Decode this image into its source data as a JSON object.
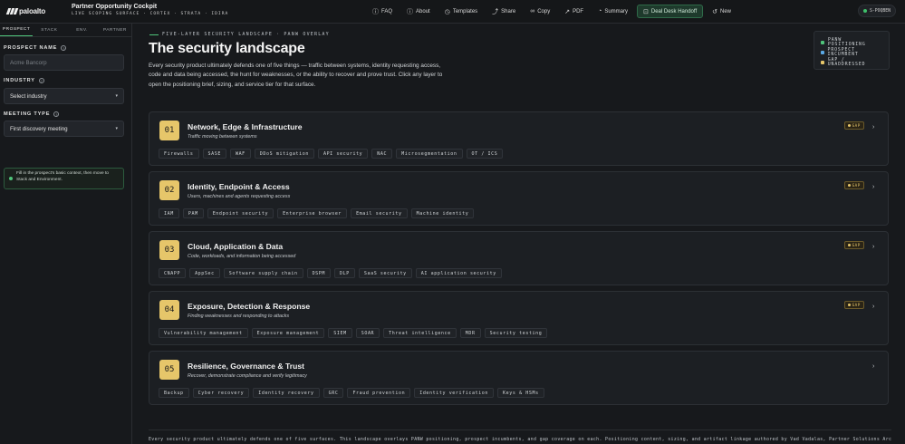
{
  "app": {
    "logo_text": "paloalto",
    "title": "Partner Opportunity Cockpit",
    "subtitle": "LIVE SCOPING SURFACE · CORTEX · STRATA · IDIRA"
  },
  "toolbar": {
    "faq": "FAQ",
    "about": "About",
    "templates": "Templates",
    "share": "Share",
    "copy": "Copy",
    "pdf": "PDF",
    "summary": "Summary",
    "handoff": "Deal Desk Handoff",
    "new": "New",
    "env_badge": "S-POQBEN"
  },
  "sidebar": {
    "tabs": [
      "PROSPECT",
      "STACK",
      "ENV.",
      "PARTNER"
    ],
    "prospect_label": "PROSPECT NAME",
    "prospect_placeholder": "Acme Bancorp",
    "industry_label": "INDUSTRY",
    "industry_value": "Select industry",
    "meeting_label": "MEETING TYPE",
    "meeting_value": "First discovery meeting",
    "hint": "Fill in the prospect's basic context, then move to Stack and Environment.",
    "help_glyph": "?"
  },
  "main": {
    "crumb_a": "FIVE-LAYER SECURITY LANDSCAPE",
    "crumb_sep": "·",
    "crumb_b": "PANW OVERLAY",
    "title": "The security landscape",
    "description": "Every security product ultimately defends one of five things — traffic between systems, identity requesting access, code and data being accessed, the hunt for weaknesses, or the ability to recover and prove trust. Click any layer to open the positioning brief, sizing, and service tier for that surface."
  },
  "legend": [
    {
      "label": "PANW POSITIONING",
      "color": "#4fc47a"
    },
    {
      "label": "PROSPECT INCUMBENT",
      "color": "#5aa9e6"
    },
    {
      "label": "GAP / UNADDRESSED",
      "color": "#e6c66a"
    }
  ],
  "layers": [
    {
      "num": "01",
      "name": "Network, Edge & Infrastructure",
      "sub": "Traffic moving between systems",
      "gap": true,
      "chips": [
        "Firewalls",
        "SASE",
        "WAF",
        "DDoS mitigation",
        "API security",
        "NAC",
        "Microsegmentation",
        "OT / ICS"
      ]
    },
    {
      "num": "02",
      "name": "Identity, Endpoint & Access",
      "sub": "Users, machines and agents requesting access",
      "gap": true,
      "chips": [
        "IAM",
        "PAM",
        "Endpoint security",
        "Enterprise browser",
        "Email security",
        "Machine identity"
      ]
    },
    {
      "num": "03",
      "name": "Cloud, Application & Data",
      "sub": "Code, workloads, and information being accessed",
      "gap": true,
      "chips": [
        "CNAPP",
        "AppSec",
        "Software supply chain",
        "DSPM",
        "DLP",
        "SaaS security",
        "AI application security"
      ]
    },
    {
      "num": "04",
      "name": "Exposure, Detection & Response",
      "sub": "Finding weaknesses and responding to attacks",
      "gap": true,
      "chips": [
        "Vulnerability management",
        "Exposure management",
        "SIEM",
        "SOAR",
        "Threat intelligence",
        "MDR",
        "Security testing"
      ]
    },
    {
      "num": "05",
      "name": "Resilience, Governance & Trust",
      "sub": "Recover, demonstrate compliance and verify legitimacy",
      "gap": false,
      "chips": [
        "Backup",
        "Cyber recovery",
        "Identity recovery",
        "GRC",
        "Fraud prevention",
        "Identity verification",
        "Keys & HSMs"
      ]
    }
  ],
  "gap_label": "GAP",
  "footer": "Every security product ultimately defends one of five surfaces. This landscape overlays PANW positioning, prospect incumbents, and gap coverage on each. Positioning content, sizing, and artifact linkage authored by Vad Vadalas, Partner Solutions Architect, Cortex."
}
